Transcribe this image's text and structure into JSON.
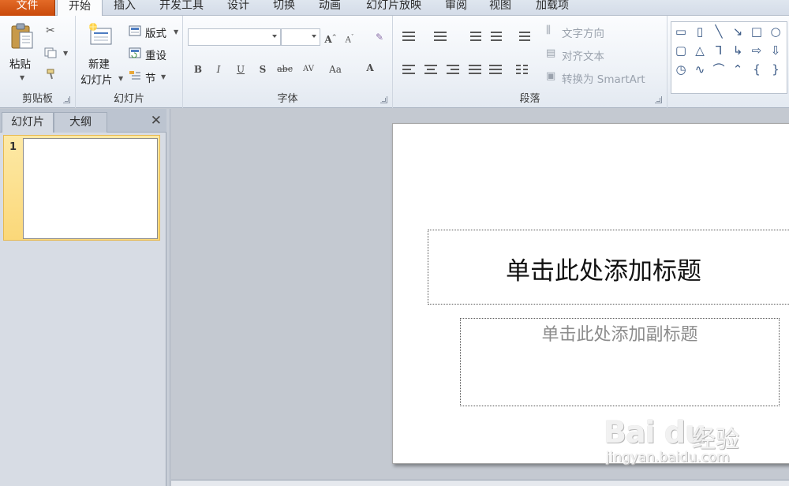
{
  "tabs": [
    {
      "label": "文件"
    },
    {
      "label": "开始"
    },
    {
      "label": "插入"
    },
    {
      "label": "开发工具"
    },
    {
      "label": "设计"
    },
    {
      "label": "切换"
    },
    {
      "label": "动画"
    },
    {
      "label": "幻灯片放映"
    },
    {
      "label": "审阅"
    },
    {
      "label": "视图"
    },
    {
      "label": "加载项"
    }
  ],
  "clipboard": {
    "paste_label": "粘贴",
    "group_label": "剪贴板"
  },
  "slides_group": {
    "new_slide_line1": "新建",
    "new_slide_line2": "幻灯片",
    "layout_label": "版式",
    "reset_label": "重设",
    "section_label": "节",
    "group_label": "幻灯片"
  },
  "font_group": {
    "font_name": "",
    "font_size": "",
    "group_label": "字体"
  },
  "paragraph_group": {
    "text_direction_label": "文字方向",
    "align_text_label": "对齐文本",
    "smartart_label": "转换为 SmartArt",
    "group_label": "段落"
  },
  "pane": {
    "tab_slides": "幻灯片",
    "tab_outline": "大纲",
    "close_glyph": "✕",
    "slide_number": "1"
  },
  "slide": {
    "title_placeholder": "单击此处添加标题",
    "subtitle_placeholder": "单击此处添加副标题"
  },
  "watermark": {
    "logo": "Bai du",
    "brand": "经验",
    "url": "jingyan.baidu.com"
  },
  "colors": {
    "file_tab": "#d9581a",
    "selection": "#fbd879"
  }
}
